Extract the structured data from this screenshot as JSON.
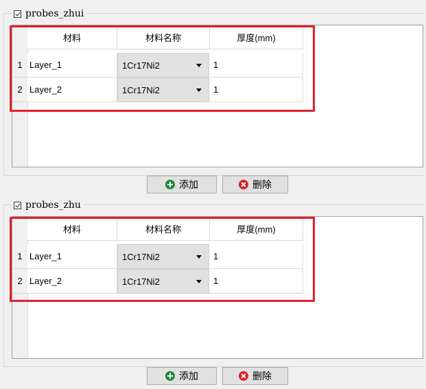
{
  "groups": [
    {
      "title": "probes_zhui",
      "headers": [
        "材料",
        "材料名称",
        "厚度(mm)"
      ],
      "rows": [
        {
          "num": "1",
          "material": "Layer_1",
          "name": "1Cr17Ni2",
          "thickness": "1"
        },
        {
          "num": "2",
          "material": "Layer_2",
          "name": "1Cr17Ni2",
          "thickness": "1"
        }
      ],
      "add_label": "添加",
      "delete_label": "删除"
    },
    {
      "title": "probes_zhu",
      "headers": [
        "材料",
        "材料名称",
        "厚度(mm)"
      ],
      "rows": [
        {
          "num": "1",
          "material": "Layer_1",
          "name": "1Cr17Ni2",
          "thickness": "1"
        },
        {
          "num": "2",
          "material": "Layer_2",
          "name": "1Cr17Ni2",
          "thickness": "1"
        }
      ],
      "add_label": "添加",
      "delete_label": "删除"
    }
  ],
  "icons": {
    "add": "plus-circle-icon",
    "delete": "x-circle-icon"
  },
  "colors": {
    "highlight": "#e0212e",
    "add_icon": "#1e8a3a",
    "delete_icon": "#d9252b"
  }
}
